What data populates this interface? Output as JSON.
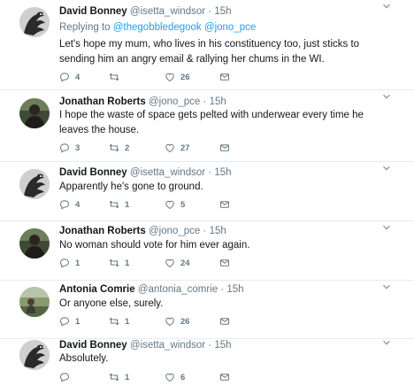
{
  "colors": {
    "link": "#1da1f2",
    "meta": "#657786",
    "text": "#14171a",
    "divider": "#e6ecf0"
  },
  "icons": {
    "reply": "reply-icon",
    "retweet": "retweet-icon",
    "like": "heart-icon",
    "dm": "envelope-icon",
    "menu": "chevron-down-icon"
  },
  "tweets": [
    {
      "name": "David Bonney",
      "handle": "@isetta_windsor",
      "dot": "·",
      "time": "15h",
      "replying_prefix": "Replying to",
      "replying_to_1": "@thegobbledegook",
      "replying_to_2": "@jono_pce",
      "text": "Let's hope my mum, who lives in his constituency too, just sticks to sending him an angry email & rallying her chums in the WI.",
      "replies": "4",
      "retweets": "",
      "likes": "26"
    },
    {
      "name": "Jonathan Roberts",
      "handle": "@jono_pce",
      "dot": "·",
      "time": "15h",
      "text": "I hope the waste of space gets pelted with underwear every time he leaves the house.",
      "replies": "3",
      "retweets": "2",
      "likes": "27"
    },
    {
      "name": "David Bonney",
      "handle": "@isetta_windsor",
      "dot": "·",
      "time": "15h",
      "text": "Apparently he's gone to ground.",
      "replies": "4",
      "retweets": "1",
      "likes": "5"
    },
    {
      "name": "Jonathan Roberts",
      "handle": "@jono_pce",
      "dot": "·",
      "time": "15h",
      "text": "No woman should vote for him ever again.",
      "replies": "1",
      "retweets": "1",
      "likes": "24"
    },
    {
      "name": "Antonia Comrie",
      "handle": "@antonia_comrie",
      "dot": "·",
      "time": "15h",
      "text": "Or anyone else, surely.",
      "replies": "1",
      "retweets": "1",
      "likes": "26"
    },
    {
      "name": "David Bonney",
      "handle": "@isetta_windsor",
      "dot": "·",
      "time": "15h",
      "text": "Absolutely.",
      "replies": "",
      "retweets": "1",
      "likes": "6"
    }
  ]
}
